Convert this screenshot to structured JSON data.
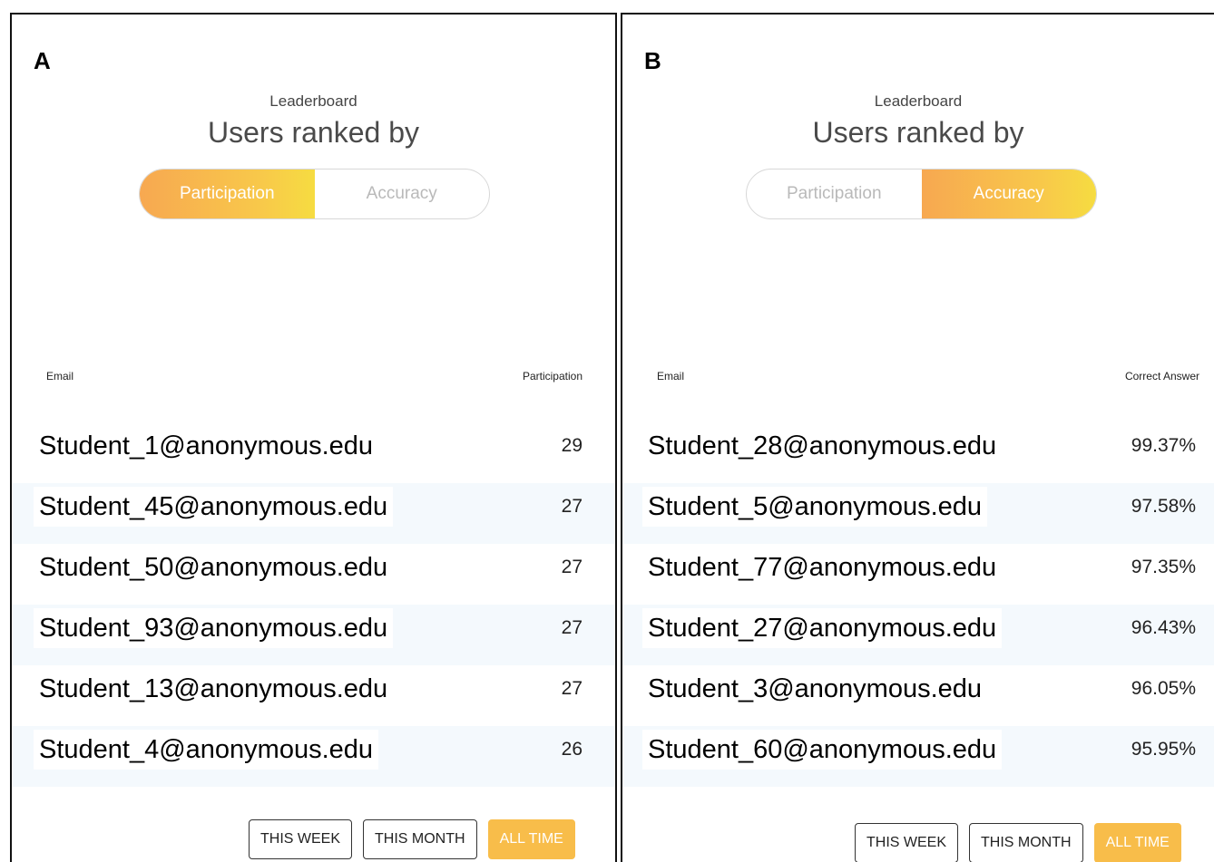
{
  "panels": [
    {
      "letter": "A",
      "caption": "Leaderboard",
      "title": "Users ranked by",
      "toggle": {
        "options": [
          "Participation",
          "Accuracy"
        ],
        "active": 0
      },
      "columns": {
        "email": "Email",
        "value": "Participation"
      },
      "rows": [
        {
          "email": "Student_1@anonymous.edu",
          "value": "29"
        },
        {
          "email": "Student_45@anonymous.edu",
          "value": "27"
        },
        {
          "email": "Student_50@anonymous.edu",
          "value": "27"
        },
        {
          "email": "Student_93@anonymous.edu",
          "value": "27"
        },
        {
          "email": "Student_13@anonymous.edu",
          "value": "27"
        },
        {
          "email": "Student_4@anonymous.edu",
          "value": "26"
        }
      ],
      "ranges": [
        "THIS WEEK",
        "THIS MONTH",
        "ALL TIME"
      ],
      "active_range": 2
    },
    {
      "letter": "B",
      "caption": "Leaderboard",
      "title": "Users ranked by",
      "toggle": {
        "options": [
          "Participation",
          "Accuracy"
        ],
        "active": 1
      },
      "columns": {
        "email": "Email",
        "value": "Correct Answer"
      },
      "rows": [
        {
          "email": "Student_28@anonymous.edu",
          "value": "99.37%"
        },
        {
          "email": "Student_5@anonymous.edu",
          "value": "97.58%"
        },
        {
          "email": "Student_77@anonymous.edu",
          "value": "97.35%"
        },
        {
          "email": "Student_27@anonymous.edu",
          "value": "96.43%"
        },
        {
          "email": "Student_3@anonymous.edu",
          "value": "96.05%"
        },
        {
          "email": "Student_60@anonymous.edu",
          "value": "95.95%"
        }
      ],
      "ranges": [
        "THIS WEEK",
        "THIS MONTH",
        "ALL TIME"
      ],
      "active_range": 2
    }
  ],
  "colors": {
    "toggle_gradient_start": "#f7a851",
    "toggle_gradient_end": "#f6dc41",
    "active_range_button": "#f8bd4a",
    "row_shade": "#f4f9fd"
  }
}
